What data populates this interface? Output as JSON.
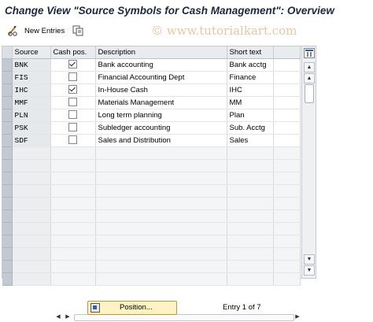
{
  "title": "Change View \"Source Symbols for Cash Management\": Overview",
  "toolbar": {
    "new_entries_label": "New Entries",
    "edit_icon": "pencil-glasses-icon",
    "copy_icon": "copy-icon"
  },
  "watermark": "© www.tutorialkart.com",
  "table": {
    "headers": {
      "source": "Source",
      "cash_pos": "Cash pos.",
      "description": "Description",
      "short_text": "Short text"
    },
    "rows": [
      {
        "source": "BNK",
        "cash_pos": true,
        "description": "Bank accounting",
        "short_text": "Bank acctg"
      },
      {
        "source": "FIS",
        "cash_pos": false,
        "description": "Financial Accounting Dept",
        "short_text": "Finance"
      },
      {
        "source": "IHC",
        "cash_pos": true,
        "description": "In-House Cash",
        "short_text": "IHC"
      },
      {
        "source": "MMF",
        "cash_pos": false,
        "description": "Materials Management",
        "short_text": "MM"
      },
      {
        "source": "PLN",
        "cash_pos": false,
        "description": "Long term planning",
        "short_text": "Plan"
      },
      {
        "source": "PSK",
        "cash_pos": false,
        "description": "Subledger accounting",
        "short_text": "Sub. Acctg"
      },
      {
        "source": "SDF",
        "cash_pos": false,
        "description": "Sales and Distribution",
        "short_text": "Sales"
      }
    ],
    "empty_rows": 11
  },
  "footer": {
    "position_button_label": "Position...",
    "entry_text": "Entry 1 of 7"
  },
  "colors": {
    "title": "#1a2840",
    "header_bg": "#e9ecef",
    "selector_column": "#c2c9d2",
    "button_bg": "#fff2c4",
    "watermark": "#e8c7a3"
  }
}
